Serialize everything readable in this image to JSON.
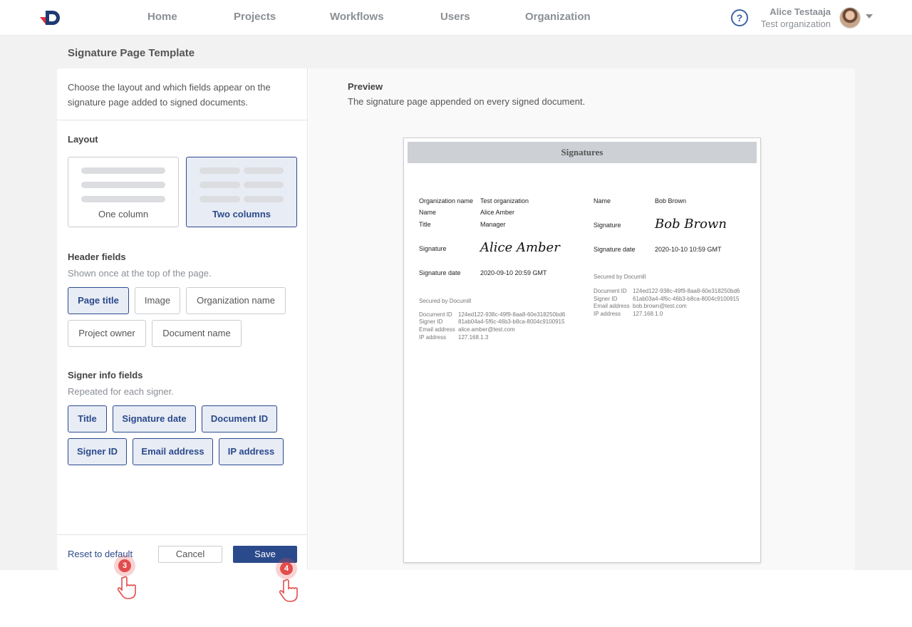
{
  "nav": {
    "items": [
      "Home",
      "Projects",
      "Workflows",
      "Users",
      "Organization"
    ],
    "help_glyph": "?",
    "user_name": "Alice Testaaja",
    "user_org": "Test organization"
  },
  "page": {
    "title": "Signature Page Template",
    "intro": "Choose the layout and which fields appear on the signature page added to signed documents."
  },
  "layout": {
    "title": "Layout",
    "options": [
      {
        "label": "One column",
        "selected": false
      },
      {
        "label": "Two columns",
        "selected": true
      }
    ]
  },
  "header_fields": {
    "title": "Header fields",
    "subtitle": "Shown once at the top of the page.",
    "chips": [
      {
        "label": "Page title",
        "on": true
      },
      {
        "label": "Image",
        "on": false
      },
      {
        "label": "Organization name",
        "on": false
      },
      {
        "label": "Project owner",
        "on": false
      },
      {
        "label": "Document name",
        "on": false
      }
    ]
  },
  "signer_fields": {
    "title": "Signer info fields",
    "subtitle": "Repeated for each signer.",
    "chips": [
      {
        "label": "Title",
        "on": true
      },
      {
        "label": "Signature date",
        "on": true
      },
      {
        "label": "Document ID",
        "on": true
      },
      {
        "label": "Signer ID",
        "on": true
      },
      {
        "label": "Email address",
        "on": true
      },
      {
        "label": "IP address",
        "on": true
      }
    ]
  },
  "footer": {
    "reset": "Reset to default",
    "cancel": "Cancel",
    "save": "Save"
  },
  "preview": {
    "title": "Preview",
    "subtitle": "The signature page appended on every signed document.",
    "header": "Signatures",
    "left": {
      "org_label": "Organization name",
      "org_value": "Test organization",
      "name_label": "Name",
      "name_value": "Alice Amber",
      "title_label": "Title",
      "title_value": "Manager",
      "sig_label": "Signature",
      "sig_value": "Alice Amber",
      "date_label": "Signature date",
      "date_value": "2020-09-10 20:59 GMT",
      "secured": "Secured by Documill",
      "doc_id_label": "Document ID",
      "doc_id": "124ed122-938c-49f9-8aa8-60e318250bd6",
      "signer_id_label": "Signer ID",
      "signer_id": "81ab04a4-5f6c-46b3-b8ca-8004c9100915",
      "email_label": "Email address",
      "email": "alice.amber@test.com",
      "ip_label": "IP address",
      "ip": "127.168.1.3"
    },
    "right": {
      "name_label": "Name",
      "name_value": "Bob Brown",
      "sig_label": "Signature",
      "sig_value": "Bob Brown",
      "date_label": "Signature date",
      "date_value": "2020-10-10 10:59 GMT",
      "secured": "Secured by Documill",
      "doc_id_label": "Document ID",
      "doc_id": "124ed122-938c-49f9-8aa8-60e318250bd6",
      "signer_id_label": "Signer ID",
      "signer_id": "61ab03a4-4f6c-46b3-b8ca-8004c9100915",
      "email_label": "Email address",
      "email": "bob.brown@test.com",
      "ip_label": "IP address",
      "ip": "127.168.1.0"
    }
  },
  "hints": [
    "3",
    "4"
  ],
  "colors": {
    "brand": "#2b4a8b",
    "logo_red": "#e0303a",
    "hint_red": "#e24c4c"
  }
}
